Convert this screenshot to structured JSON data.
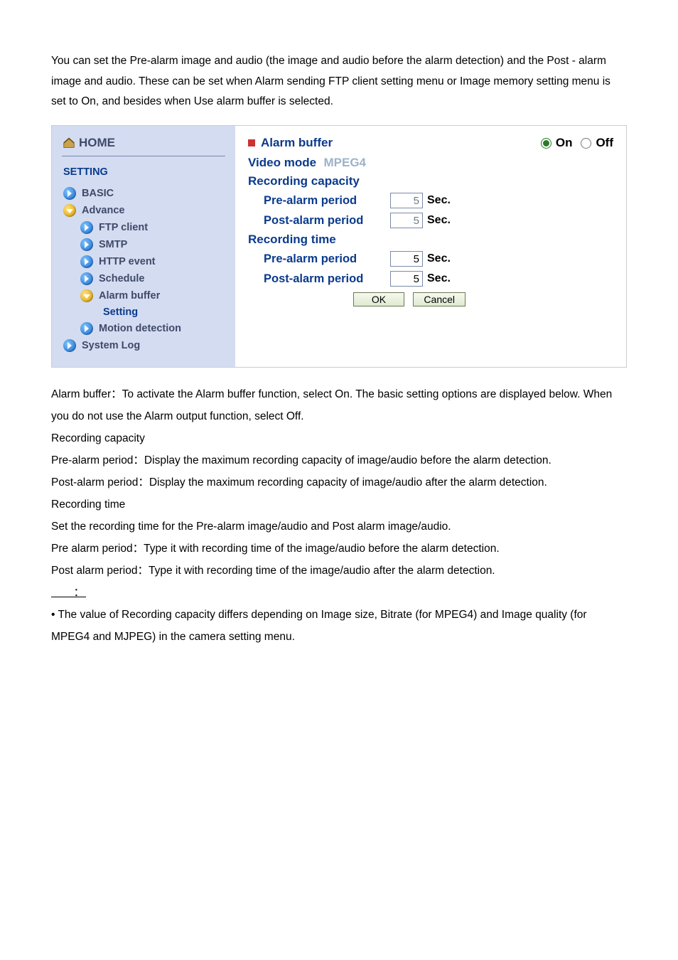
{
  "intro": "You can set the Pre-alarm image and audio (the image and audio before the alarm detection) and the Post - alarm image and audio. These can be set when Alarm sending FTP client setting menu or Image memory setting menu is set to On, and besides when Use alarm buffer is selected.",
  "sidebar": {
    "home": "HOME",
    "setting": "SETTING",
    "basic": "BASIC",
    "advance": "Advance",
    "ftp": "FTP client",
    "smtp": "SMTP",
    "http": "HTTP event",
    "schedule": "Schedule",
    "alarm_buffer": "Alarm buffer",
    "setting_item": "Setting",
    "motion": "Motion detection",
    "syslog": "System Log"
  },
  "main": {
    "title": "Alarm buffer",
    "on": "On",
    "off": "Off",
    "video_mode_label": "Video mode",
    "video_mode_value": "MPEG4",
    "rec_capacity": "Recording capacity",
    "rec_time": "Recording time",
    "pre_label": "Pre-alarm period",
    "post_label": "Post-alarm period",
    "cap_pre_val": "5",
    "cap_post_val": "5",
    "time_pre_val": "5",
    "time_post_val": "5",
    "sec": "Sec.",
    "ok": "OK",
    "cancel": "Cancel"
  },
  "desc": {
    "p1": "Alarm buffer：To activate the Alarm buffer function, select On. The basic setting options are displayed below. When you do not use the Alarm output function, select Off.",
    "p2": "Recording capacity",
    "p3": "Pre-alarm period：Display the maximum recording capacity of image/audio before the alarm detection.",
    "p4": "Post-alarm period：Display the maximum recording capacity of image/audio after the alarm detection.",
    "p5": "Recording time",
    "p6": "Set the recording time for the Pre-alarm image/audio and Post alarm image/audio.",
    "p7": "Pre alarm period：Type it with recording time of the image/audio before the alarm detection.",
    "p8": "Post alarm period：Type it with recording time of the image/audio after the alarm detection.",
    "noteWord": "     ：",
    "note": "• The value of Recording capacity differs depending on Image size, Bitrate (for MPEG4) and Image quality (for MPEG4 and MJPEG) in the camera setting menu."
  }
}
